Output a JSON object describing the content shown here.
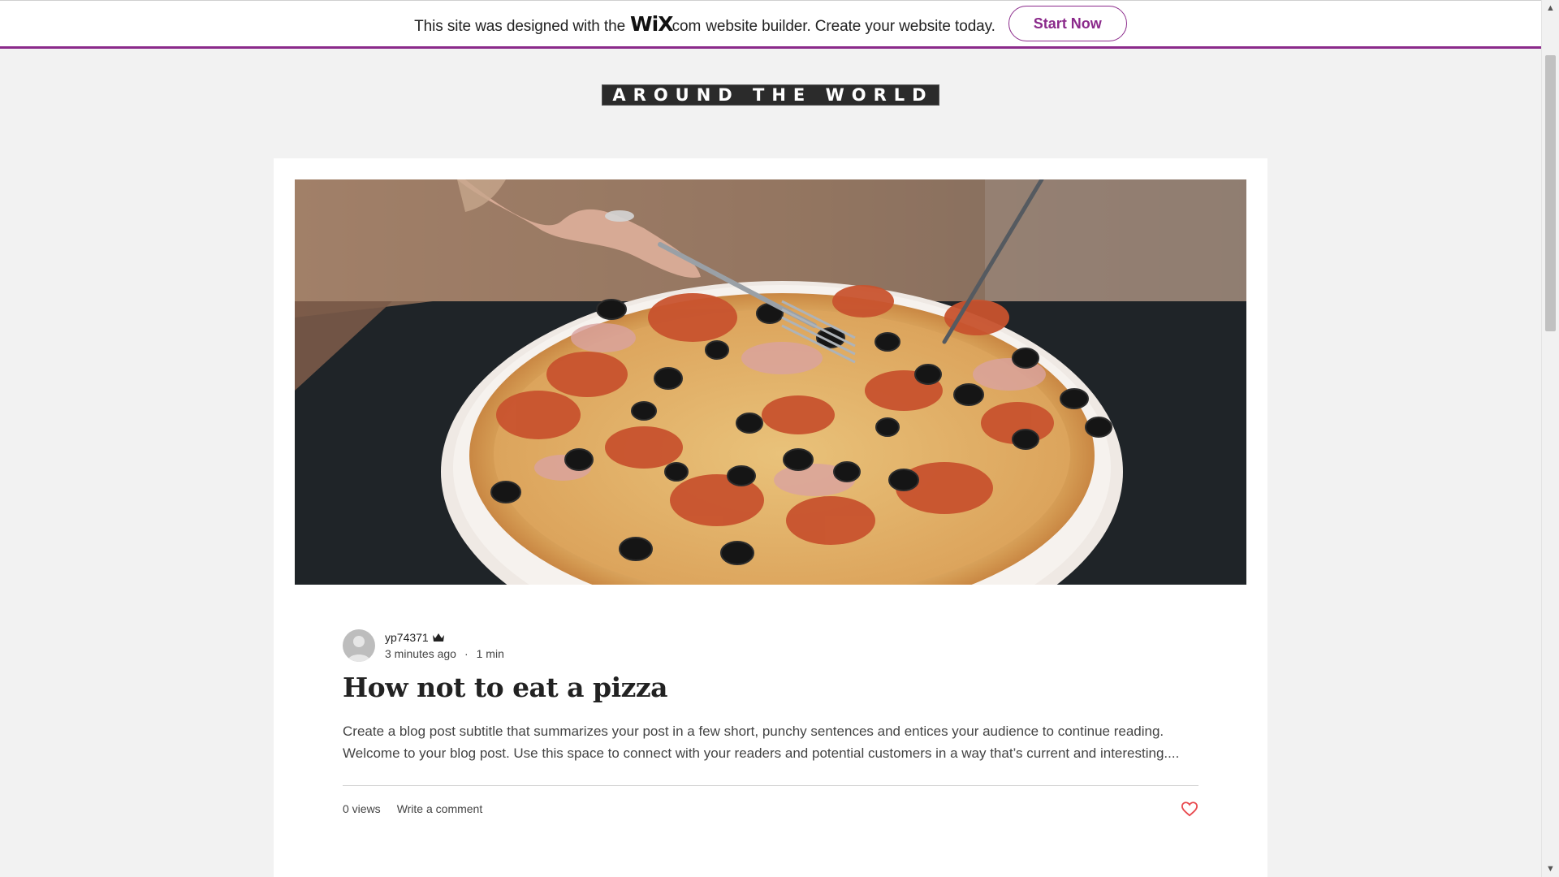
{
  "banner": {
    "text_before": "This site was designed with the",
    "logo_word": "WiX",
    "logo_suffix": ".com",
    "text_after": "website builder. Create your website today.",
    "button_label": "Start Now",
    "accent_color": "#8b2a8b"
  },
  "site": {
    "title": "AROUND THE WORLD"
  },
  "post": {
    "cover_image_icon": "pizza-photo",
    "author": {
      "name": "yp74371",
      "badge_icon": "crown-icon"
    },
    "time_ago": "3 minutes ago",
    "separator": "·",
    "read_time": "1 min",
    "title": "How not to eat a pizza",
    "excerpt": "Create a blog post subtitle that summarizes your post in a few short, punchy sentences and entices your audience to continue reading. Welcome to your blog post. Use this space to connect with your readers and potential customers in a way that’s current and interesting....",
    "views": "0 views",
    "comment_link": "Write a comment",
    "like_icon": "heart-icon",
    "like_color": "#e8484d"
  },
  "scrollbar": {
    "up_icon": "scroll-up-arrow-icon",
    "down_icon": "scroll-down-arrow-icon"
  }
}
